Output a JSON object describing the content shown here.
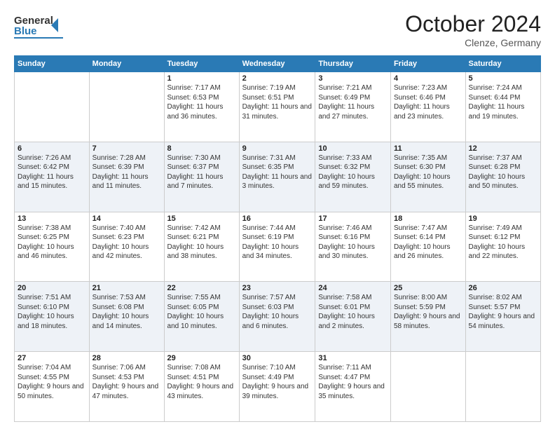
{
  "header": {
    "logo_general": "General",
    "logo_blue": "Blue",
    "month_title": "October 2024",
    "location": "Clenze, Germany"
  },
  "days_of_week": [
    "Sunday",
    "Monday",
    "Tuesday",
    "Wednesday",
    "Thursday",
    "Friday",
    "Saturday"
  ],
  "weeks": [
    [
      {
        "day": "",
        "info": ""
      },
      {
        "day": "",
        "info": ""
      },
      {
        "day": "1",
        "info": "Sunrise: 7:17 AM\nSunset: 6:53 PM\nDaylight: 11 hours and 36 minutes."
      },
      {
        "day": "2",
        "info": "Sunrise: 7:19 AM\nSunset: 6:51 PM\nDaylight: 11 hours and 31 minutes."
      },
      {
        "day": "3",
        "info": "Sunrise: 7:21 AM\nSunset: 6:49 PM\nDaylight: 11 hours and 27 minutes."
      },
      {
        "day": "4",
        "info": "Sunrise: 7:23 AM\nSunset: 6:46 PM\nDaylight: 11 hours and 23 minutes."
      },
      {
        "day": "5",
        "info": "Sunrise: 7:24 AM\nSunset: 6:44 PM\nDaylight: 11 hours and 19 minutes."
      }
    ],
    [
      {
        "day": "6",
        "info": "Sunrise: 7:26 AM\nSunset: 6:42 PM\nDaylight: 11 hours and 15 minutes."
      },
      {
        "day": "7",
        "info": "Sunrise: 7:28 AM\nSunset: 6:39 PM\nDaylight: 11 hours and 11 minutes."
      },
      {
        "day": "8",
        "info": "Sunrise: 7:30 AM\nSunset: 6:37 PM\nDaylight: 11 hours and 7 minutes."
      },
      {
        "day": "9",
        "info": "Sunrise: 7:31 AM\nSunset: 6:35 PM\nDaylight: 11 hours and 3 minutes."
      },
      {
        "day": "10",
        "info": "Sunrise: 7:33 AM\nSunset: 6:32 PM\nDaylight: 10 hours and 59 minutes."
      },
      {
        "day": "11",
        "info": "Sunrise: 7:35 AM\nSunset: 6:30 PM\nDaylight: 10 hours and 55 minutes."
      },
      {
        "day": "12",
        "info": "Sunrise: 7:37 AM\nSunset: 6:28 PM\nDaylight: 10 hours and 50 minutes."
      }
    ],
    [
      {
        "day": "13",
        "info": "Sunrise: 7:38 AM\nSunset: 6:25 PM\nDaylight: 10 hours and 46 minutes."
      },
      {
        "day": "14",
        "info": "Sunrise: 7:40 AM\nSunset: 6:23 PM\nDaylight: 10 hours and 42 minutes."
      },
      {
        "day": "15",
        "info": "Sunrise: 7:42 AM\nSunset: 6:21 PM\nDaylight: 10 hours and 38 minutes."
      },
      {
        "day": "16",
        "info": "Sunrise: 7:44 AM\nSunset: 6:19 PM\nDaylight: 10 hours and 34 minutes."
      },
      {
        "day": "17",
        "info": "Sunrise: 7:46 AM\nSunset: 6:16 PM\nDaylight: 10 hours and 30 minutes."
      },
      {
        "day": "18",
        "info": "Sunrise: 7:47 AM\nSunset: 6:14 PM\nDaylight: 10 hours and 26 minutes."
      },
      {
        "day": "19",
        "info": "Sunrise: 7:49 AM\nSunset: 6:12 PM\nDaylight: 10 hours and 22 minutes."
      }
    ],
    [
      {
        "day": "20",
        "info": "Sunrise: 7:51 AM\nSunset: 6:10 PM\nDaylight: 10 hours and 18 minutes."
      },
      {
        "day": "21",
        "info": "Sunrise: 7:53 AM\nSunset: 6:08 PM\nDaylight: 10 hours and 14 minutes."
      },
      {
        "day": "22",
        "info": "Sunrise: 7:55 AM\nSunset: 6:05 PM\nDaylight: 10 hours and 10 minutes."
      },
      {
        "day": "23",
        "info": "Sunrise: 7:57 AM\nSunset: 6:03 PM\nDaylight: 10 hours and 6 minutes."
      },
      {
        "day": "24",
        "info": "Sunrise: 7:58 AM\nSunset: 6:01 PM\nDaylight: 10 hours and 2 minutes."
      },
      {
        "day": "25",
        "info": "Sunrise: 8:00 AM\nSunset: 5:59 PM\nDaylight: 9 hours and 58 minutes."
      },
      {
        "day": "26",
        "info": "Sunrise: 8:02 AM\nSunset: 5:57 PM\nDaylight: 9 hours and 54 minutes."
      }
    ],
    [
      {
        "day": "27",
        "info": "Sunrise: 7:04 AM\nSunset: 4:55 PM\nDaylight: 9 hours and 50 minutes."
      },
      {
        "day": "28",
        "info": "Sunrise: 7:06 AM\nSunset: 4:53 PM\nDaylight: 9 hours and 47 minutes."
      },
      {
        "day": "29",
        "info": "Sunrise: 7:08 AM\nSunset: 4:51 PM\nDaylight: 9 hours and 43 minutes."
      },
      {
        "day": "30",
        "info": "Sunrise: 7:10 AM\nSunset: 4:49 PM\nDaylight: 9 hours and 39 minutes."
      },
      {
        "day": "31",
        "info": "Sunrise: 7:11 AM\nSunset: 4:47 PM\nDaylight: 9 hours and 35 minutes."
      },
      {
        "day": "",
        "info": ""
      },
      {
        "day": "",
        "info": ""
      }
    ]
  ]
}
